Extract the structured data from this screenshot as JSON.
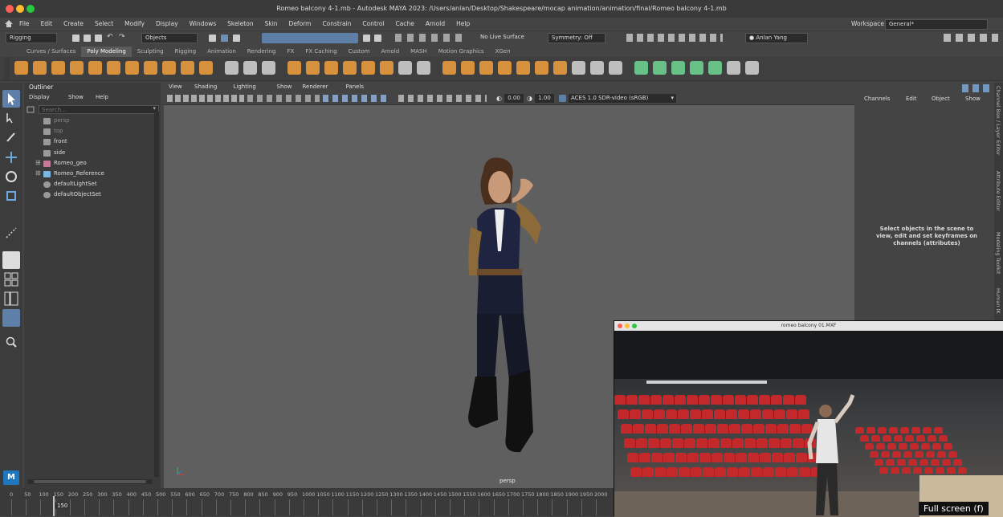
{
  "window": {
    "title": "Romeo balcony 4-1.mb - Autodesk MAYA 2023: /Users/anlan/Desktop/Shakespeare/mocap animation/animation/final/Romeo balcony 4-1.mb"
  },
  "menubar": {
    "items": [
      "File",
      "Edit",
      "Create",
      "Select",
      "Modify",
      "Display",
      "Windows",
      "Skeleton",
      "Skin",
      "Deform",
      "Constrain",
      "Control",
      "Cache",
      "Arnold",
      "Help"
    ],
    "workspace_label": "Workspace:",
    "workspace_value": "General*"
  },
  "statusline": {
    "menuset": "Rigging",
    "select_mode": "Objects",
    "live_surface": "No Live Surface",
    "symmetry": "Symmetry: Off",
    "user": "Anlan Yang"
  },
  "shelf": {
    "tabs": [
      "Curves / Surfaces",
      "Poly Modeling",
      "Sculpting",
      "Rigging",
      "Animation",
      "Rendering",
      "FX",
      "FX Caching",
      "Custom",
      "Arnold",
      "MASH",
      "Motion Graphics",
      "XGen"
    ],
    "active_tab": "Poly Modeling"
  },
  "outliner": {
    "title": "Outliner",
    "menu": [
      "Display",
      "Show",
      "Help"
    ],
    "search_placeholder": "Search...",
    "items": [
      {
        "label": "persp",
        "dim": true,
        "expand": false,
        "icon": "camera"
      },
      {
        "label": "top",
        "dim": true,
        "expand": false,
        "icon": "camera"
      },
      {
        "label": "front",
        "dim": false,
        "expand": false,
        "icon": "camera"
      },
      {
        "label": "side",
        "dim": false,
        "expand": false,
        "icon": "camera"
      },
      {
        "label": "Romeo_geo",
        "dim": false,
        "expand": true,
        "icon": "mesh"
      },
      {
        "label": "Romeo_Reference",
        "dim": false,
        "expand": true,
        "icon": "joint"
      },
      {
        "label": "defaultLightSet",
        "dim": false,
        "expand": false,
        "icon": "set"
      },
      {
        "label": "defaultObjectSet",
        "dim": false,
        "expand": false,
        "icon": "set"
      }
    ]
  },
  "viewport": {
    "menu": [
      "View",
      "Shading",
      "Lighting",
      "Show",
      "Renderer",
      "Panels"
    ],
    "exposure": "0.00",
    "gamma": "1.00",
    "color_space": "ACES 1.0 SDR-video (sRGB)",
    "camera_label": "persp"
  },
  "channelbox": {
    "menu": [
      "Channels",
      "Edit",
      "Object",
      "Show"
    ],
    "hint": "Select objects in the scene to view, edit and set keyframes on channels (attributes)"
  },
  "sidetabs": [
    "Channel Box / Layer Editor",
    "Attribute Editor",
    "Modeling Toolkit",
    "Human IK"
  ],
  "timeline": {
    "ticks": [
      "0",
      "50",
      "100",
      "150",
      "200",
      "250",
      "300",
      "350",
      "400",
      "450",
      "500",
      "550",
      "600",
      "650",
      "700",
      "750",
      "800",
      "850",
      "900",
      "950",
      "1000",
      "1050",
      "1100",
      "1150",
      "1200",
      "1250",
      "1300",
      "1350",
      "1400",
      "1450",
      "1500",
      "1550",
      "1600",
      "1650",
      "1700",
      "1750",
      "1800",
      "1850",
      "1900",
      "1950",
      "2000"
    ],
    "current_frame": "150"
  },
  "video": {
    "title": "romeo balcony 01.MXF",
    "fullscreen_hint": "Full screen (f)"
  }
}
